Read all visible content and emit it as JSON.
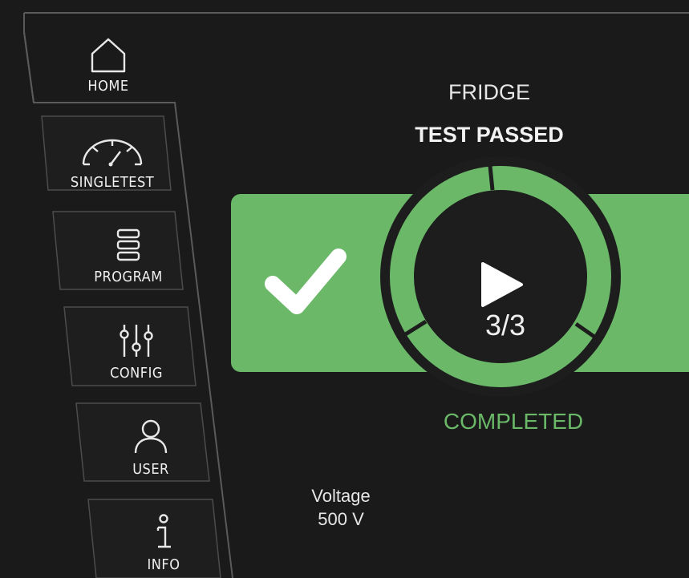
{
  "nav": {
    "home_label": "HOME",
    "singletest_label": "SINGLETEST",
    "program_label": "PROGRAM",
    "config_label": "CONFIG",
    "user_label": "USER",
    "info_label": "INFO"
  },
  "main": {
    "device_name": "FRIDGE",
    "test_status": "TEST PASSED",
    "progress_count": "3/3",
    "progress_fraction": 1.0,
    "result_label": "COMPLETED",
    "voltage_label": "Voltage",
    "voltage_value": "500 V"
  },
  "icons": {
    "home": "home-icon",
    "singletest": "gauge-icon",
    "program": "list-icon",
    "config": "sliders-icon",
    "user": "user-icon",
    "info": "info-icon",
    "status": "checkmark-icon",
    "play": "play-icon"
  },
  "colors": {
    "background": "#1a1a1a",
    "accent_green": "#6ab868",
    "ring_inner": "#1d1d1d",
    "text": "#f0f0f0"
  }
}
